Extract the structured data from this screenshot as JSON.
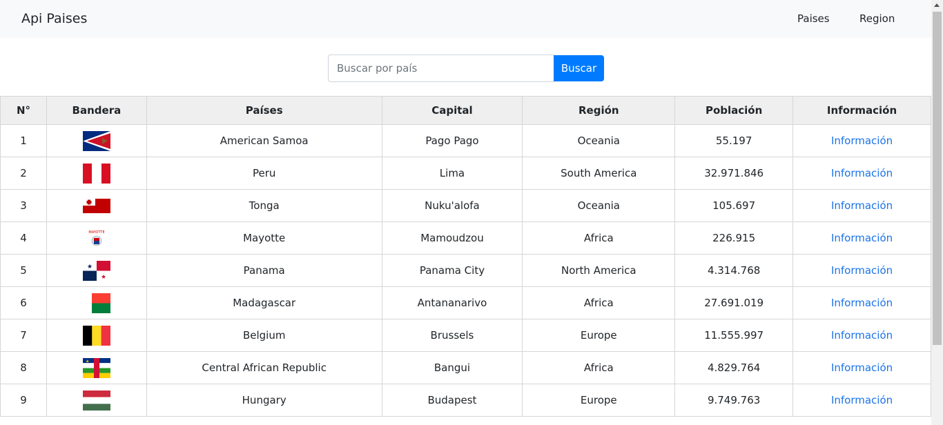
{
  "navbar": {
    "brand": "Api Paises",
    "links": [
      "Paises",
      "Region"
    ]
  },
  "search": {
    "placeholder": "Buscar por país",
    "button": "Buscar"
  },
  "table": {
    "headers": [
      "N°",
      "Bandera",
      "Países",
      "Capital",
      "Región",
      "Población",
      "Información"
    ],
    "link_label": "Información",
    "rows": [
      {
        "n": "1",
        "flag": "american-samoa-flag",
        "country": "American Samoa",
        "capital": "Pago Pago",
        "region": "Oceania",
        "population": "55.197"
      },
      {
        "n": "2",
        "flag": "peru-flag",
        "country": "Peru",
        "capital": "Lima",
        "region": "South America",
        "population": "32.971.846"
      },
      {
        "n": "3",
        "flag": "tonga-flag",
        "country": "Tonga",
        "capital": "Nuku'alofa",
        "region": "Oceania",
        "population": "105.697"
      },
      {
        "n": "4",
        "flag": "mayotte-flag",
        "country": "Mayotte",
        "capital": "Mamoudzou",
        "region": "Africa",
        "population": "226.915"
      },
      {
        "n": "5",
        "flag": "panama-flag",
        "country": "Panama",
        "capital": "Panama City",
        "region": "North America",
        "population": "4.314.768"
      },
      {
        "n": "6",
        "flag": "madagascar-flag",
        "country": "Madagascar",
        "capital": "Antananarivo",
        "region": "Africa",
        "population": "27.691.019"
      },
      {
        "n": "7",
        "flag": "belgium-flag",
        "country": "Belgium",
        "capital": "Brussels",
        "region": "Europe",
        "population": "11.555.997"
      },
      {
        "n": "8",
        "flag": "central-african-republic-flag",
        "country": "Central African Republic",
        "capital": "Bangui",
        "region": "Africa",
        "population": "4.829.764"
      },
      {
        "n": "9",
        "flag": "hungary-flag",
        "country": "Hungary",
        "capital": "Budapest",
        "region": "Europe",
        "population": "9.749.763"
      }
    ]
  },
  "colors": {
    "accent": "#007bff",
    "link": "#1a73e8",
    "navbar_bg": "#f8f9fa"
  }
}
